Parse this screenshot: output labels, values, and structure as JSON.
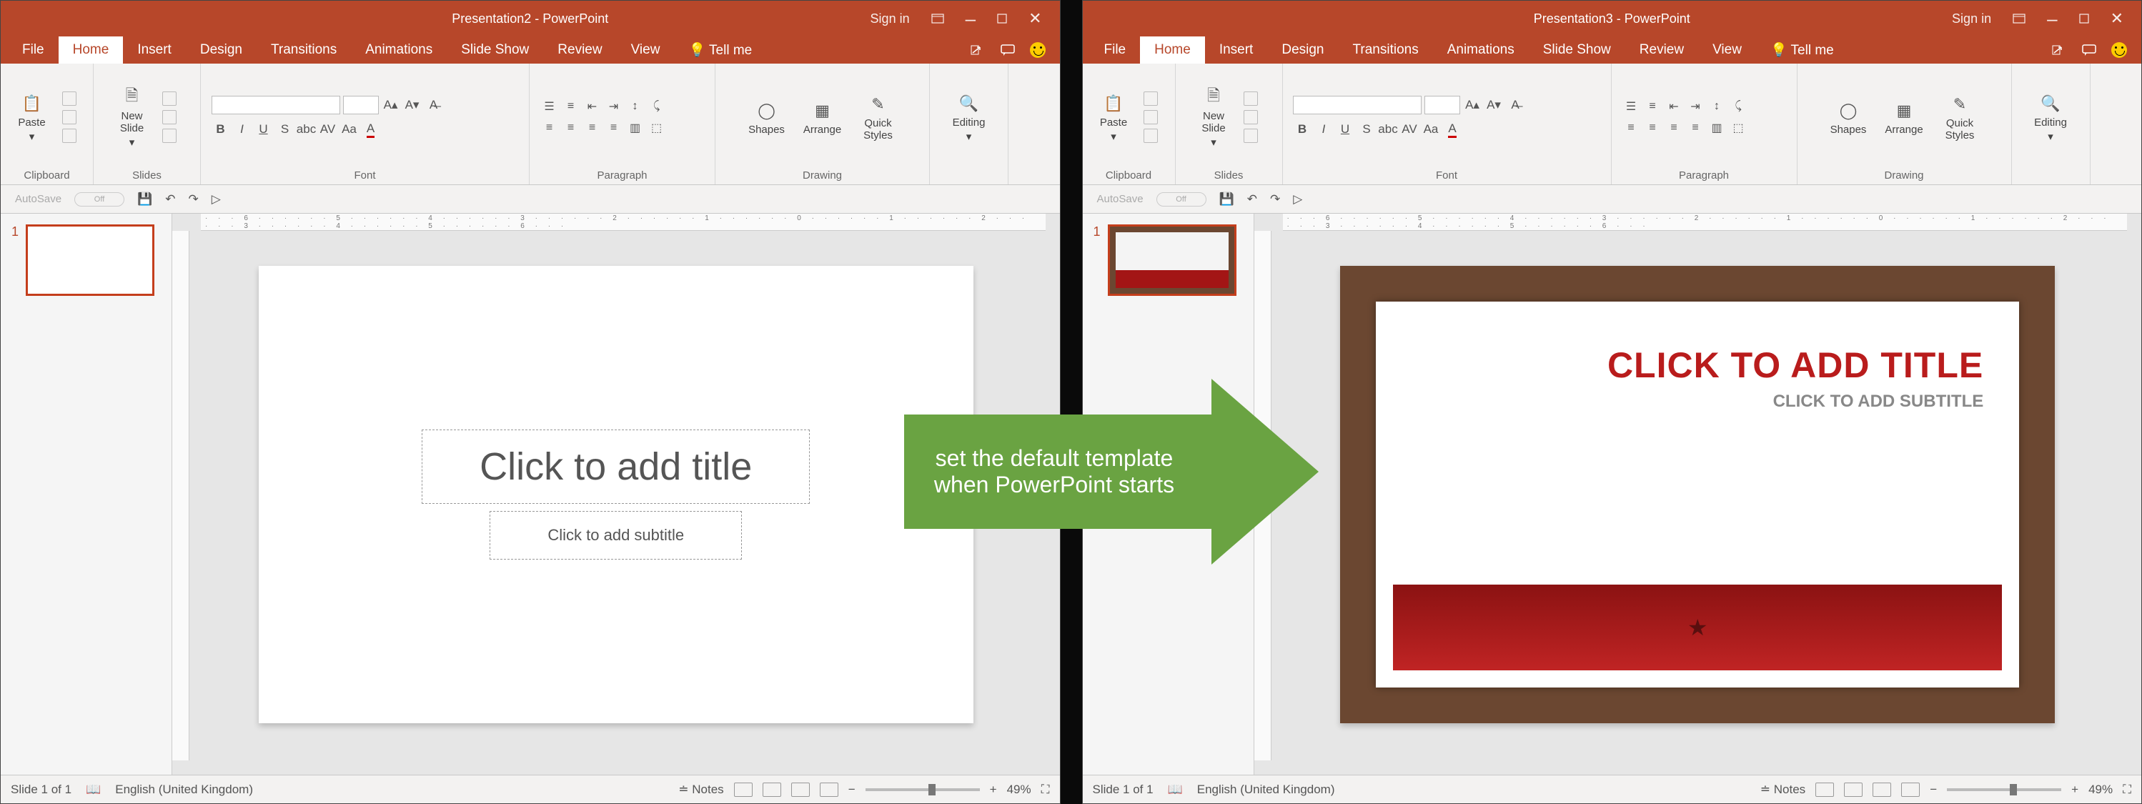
{
  "left": {
    "titlebar": {
      "title": "Presentation2  -  PowerPoint",
      "signin": "Sign in"
    },
    "tabs": [
      "File",
      "Home",
      "Insert",
      "Design",
      "Transitions",
      "Animations",
      "Slide Show",
      "Review",
      "View"
    ],
    "active_tab": "Home",
    "tellme": "Tell me",
    "ribbon_groups": {
      "clipboard": {
        "label": "Clipboard",
        "paste": "Paste"
      },
      "slides": {
        "label": "Slides",
        "newslide": "New\nSlide"
      },
      "font": {
        "label": "Font"
      },
      "paragraph": {
        "label": "Paragraph"
      },
      "drawing": {
        "label": "Drawing",
        "shapes": "Shapes",
        "arrange": "Arrange",
        "styles": "Quick\nStyles"
      },
      "editing": {
        "label": "Editing"
      }
    },
    "qat": {
      "autosave": "AutoSave",
      "off": "Off"
    },
    "thumbs": {
      "num": "1"
    },
    "slide": {
      "title_ph": "Click to add title",
      "sub_ph": "Click to add subtitle"
    },
    "status": {
      "slide": "Slide 1 of 1",
      "lang": "English (United Kingdom)",
      "notes": "Notes",
      "zoom": "49%"
    }
  },
  "right": {
    "titlebar": {
      "title": "Presentation3  -  PowerPoint",
      "signin": "Sign in"
    },
    "tabs": [
      "File",
      "Home",
      "Insert",
      "Design",
      "Transitions",
      "Animations",
      "Slide Show",
      "Review",
      "View"
    ],
    "active_tab": "Home",
    "tellme": "Tell me",
    "ribbon_groups": {
      "clipboard": {
        "label": "Clipboard",
        "paste": "Paste"
      },
      "slides": {
        "label": "Slides",
        "newslide": "New\nSlide"
      },
      "font": {
        "label": "Font"
      },
      "paragraph": {
        "label": "Paragraph"
      },
      "drawing": {
        "label": "Drawing",
        "shapes": "Shapes",
        "arrange": "Arrange",
        "styles": "Quick\nStyles"
      },
      "editing": {
        "label": "Editing"
      }
    },
    "qat": {
      "autosave": "AutoSave",
      "off": "Off"
    },
    "thumbs": {
      "num": "1"
    },
    "slide": {
      "title_ph": "CLICK TO ADD TITLE",
      "sub_ph": "CLICK TO ADD SUBTITLE"
    },
    "status": {
      "slide": "Slide 1 of 1",
      "lang": "English (United Kingdom)",
      "notes": "Notes",
      "zoom": "49%"
    }
  },
  "callout": {
    "line1": "set the default template",
    "line2": "when PowerPoint starts"
  },
  "ruler_marks": "· · · 6 · · · · · · 5 · · · · · · 4 · · · · · · 3 · · · · · · 2 · · · · · · 1 · · · · · · 0 · · · · · · 1 · · · · · · 2 · · · · · · 3 · · · · · · 4 · · · · · · 5 · · · · · · 6 · · ·"
}
